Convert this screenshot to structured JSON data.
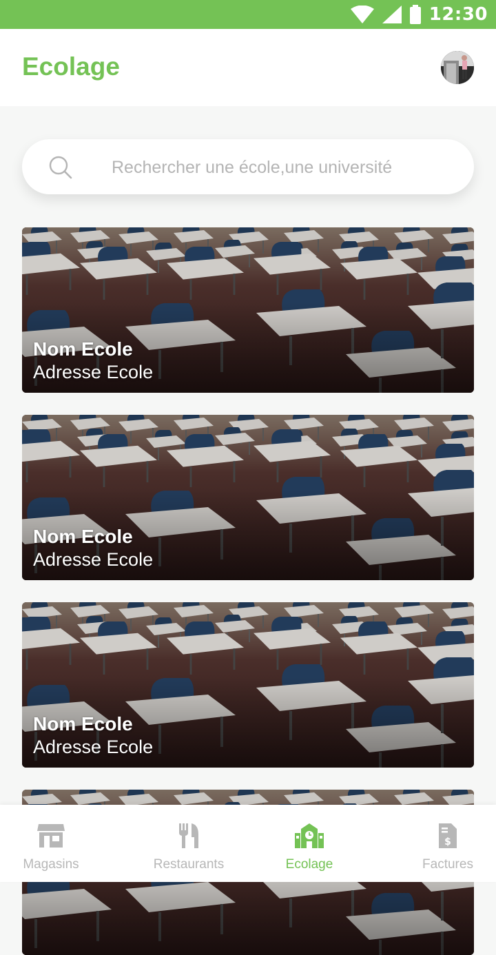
{
  "status_bar": {
    "time": "12:30",
    "icons": [
      "wifi-icon",
      "signal-icon",
      "battery-icon"
    ]
  },
  "header": {
    "title": "Ecolage",
    "avatar": "user-avatar"
  },
  "search": {
    "placeholder": "Rechercher une école,une université",
    "value": ""
  },
  "schools": [
    {
      "name": "Nom Ecole",
      "address": "Adresse Ecole"
    },
    {
      "name": "Nom Ecole",
      "address": "Adresse Ecole"
    },
    {
      "name": "Nom Ecole",
      "address": "Adresse Ecole"
    },
    {
      "name": "",
      "address": ""
    }
  ],
  "nav": {
    "items": [
      {
        "label": "Magasins",
        "icon": "store-icon",
        "active": false
      },
      {
        "label": "Restaurants",
        "icon": "fork-knife-icon",
        "active": false
      },
      {
        "label": "Ecolage",
        "icon": "school-icon",
        "active": true
      },
      {
        "label": "Factures",
        "icon": "invoice-icon",
        "active": false
      }
    ]
  },
  "colors": {
    "accent": "#74c255",
    "inactive": "#b7b7b7",
    "background": "#f6f7f6"
  }
}
